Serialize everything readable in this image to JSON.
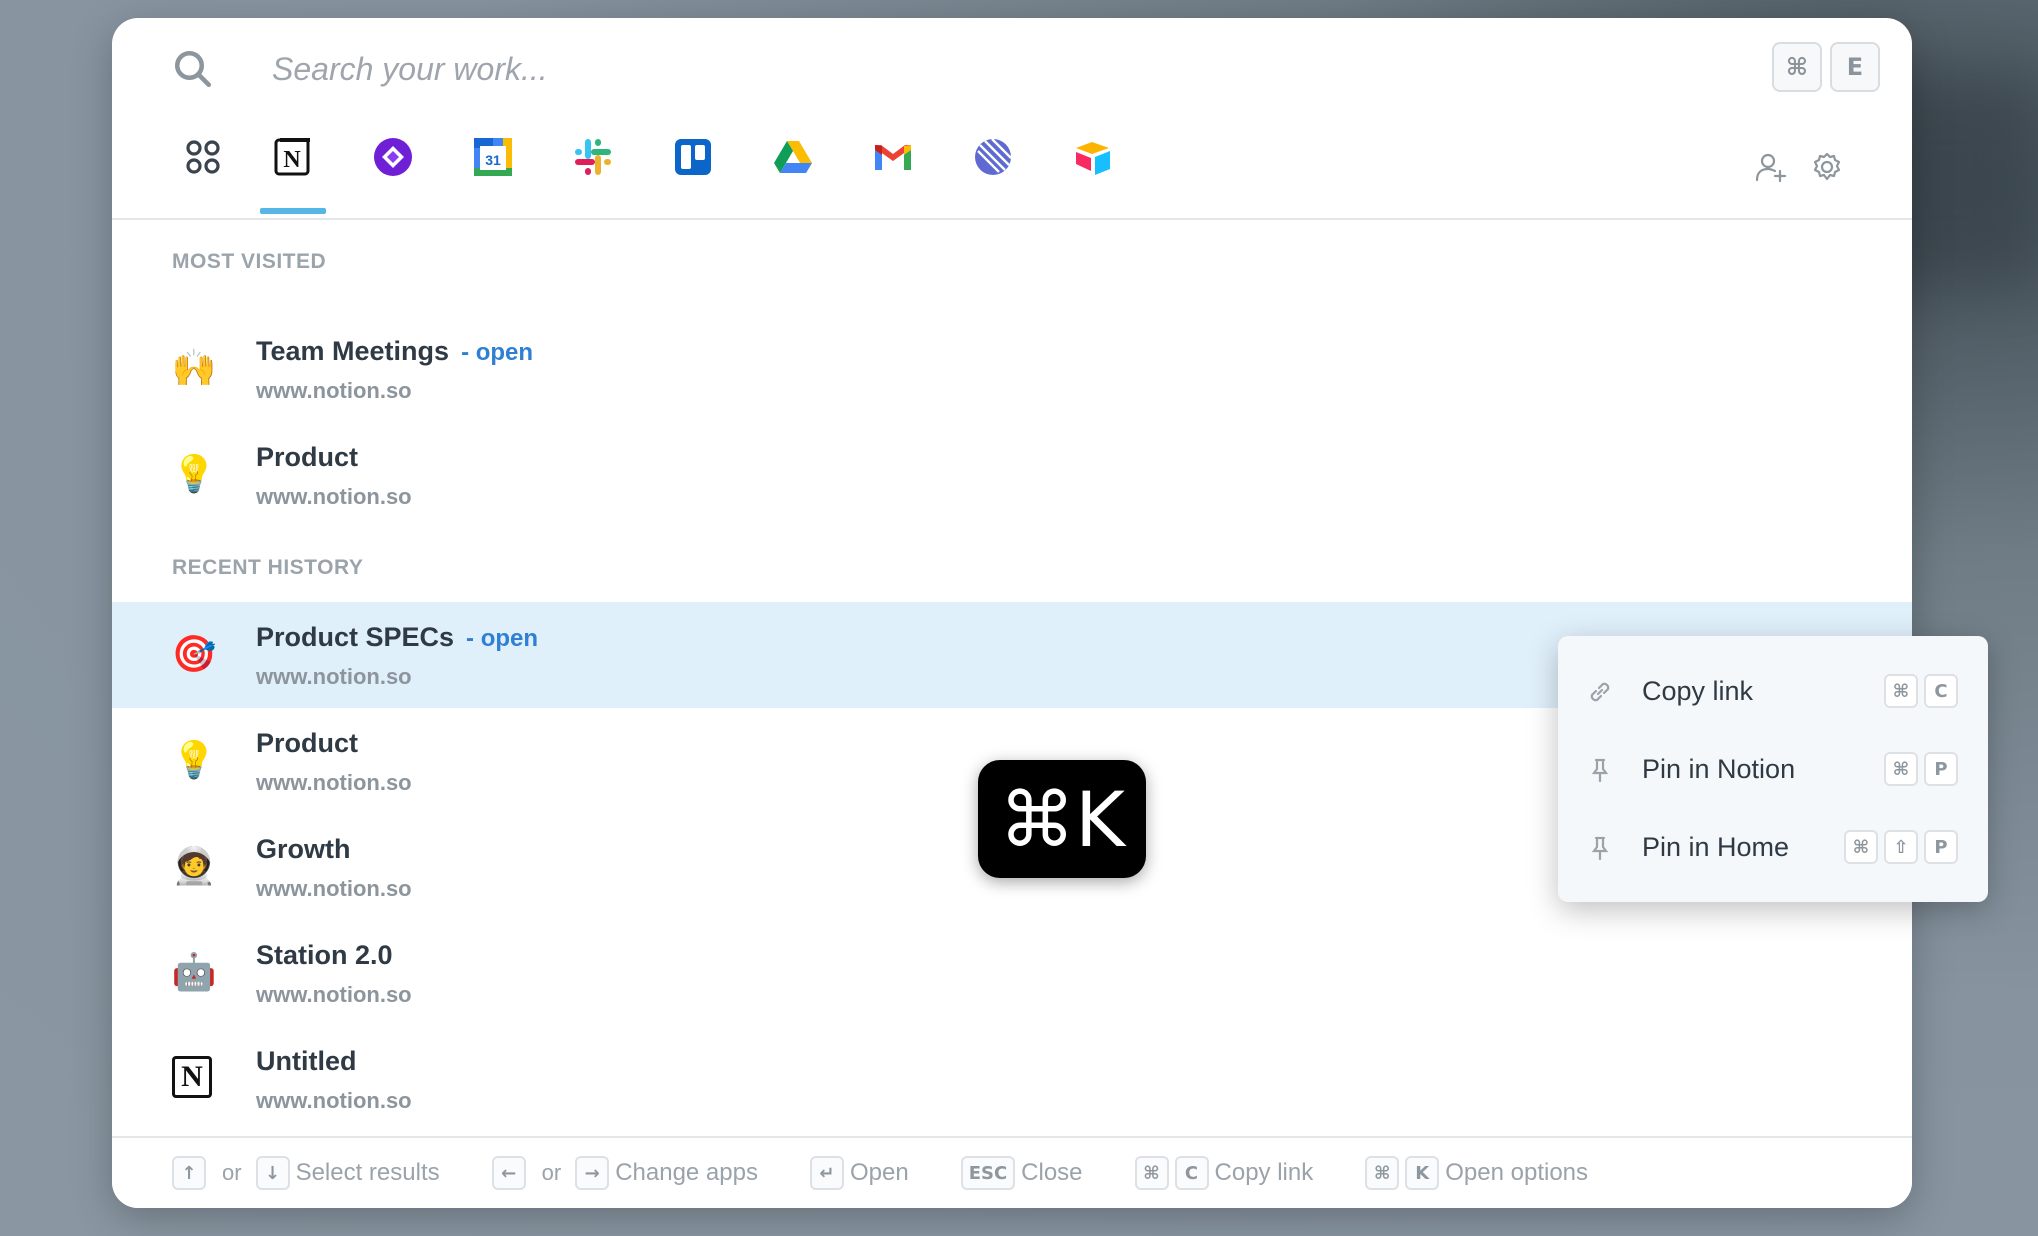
{
  "search": {
    "placeholder": "Search your work...",
    "shortcut": [
      "⌘",
      "E"
    ]
  },
  "apps": [
    {
      "name": "all-apps-icon"
    },
    {
      "name": "notion-icon"
    },
    {
      "name": "clickup-icon"
    },
    {
      "name": "google-calendar-icon",
      "label": "31"
    },
    {
      "name": "slack-icon"
    },
    {
      "name": "trello-icon"
    },
    {
      "name": "google-drive-icon"
    },
    {
      "name": "gmail-icon"
    },
    {
      "name": "linear-icon"
    },
    {
      "name": "airtable-icon"
    }
  ],
  "sections": {
    "most_visited": "MOST VISITED",
    "recent_history": "RECENT HISTORY"
  },
  "most_visited": [
    {
      "emoji": "🙌",
      "title": "Team Meetings",
      "open": "- open",
      "url": "www.notion.so"
    },
    {
      "emoji": "💡",
      "title": "Product",
      "url": "www.notion.so"
    }
  ],
  "recent_history": [
    {
      "emoji": "🎯",
      "title": "Product SPECs",
      "open": "- open",
      "url": "www.notion.so"
    },
    {
      "emoji": "💡",
      "title": "Product",
      "url": "www.notion.so"
    },
    {
      "emoji": "🧑‍🚀",
      "title": "Growth",
      "url": "www.notion.so"
    },
    {
      "emoji": "🤖",
      "title": "Station 2.0",
      "url": "www.notion.so"
    },
    {
      "emoji": "N",
      "title": "Untitled",
      "url": "www.notion.so"
    }
  ],
  "footer": {
    "up": "↑",
    "down": "↓",
    "or": "or",
    "select": "Select results",
    "left": "←",
    "right": "→",
    "change": "Change apps",
    "enter": "↵",
    "open": "Open",
    "esc": "ESC",
    "close": "Close",
    "cmd": "⌘",
    "c": "C",
    "copy": "Copy link",
    "k": "K",
    "options": "Open options"
  },
  "cmdk_badge": "⌘K",
  "context_menu": [
    {
      "label": "Copy link",
      "keys": [
        "⌘",
        "C"
      ]
    },
    {
      "label": "Pin in Notion",
      "keys": [
        "⌘",
        "P"
      ]
    },
    {
      "label": "Pin in Home",
      "keys": [
        "⌘",
        "⇧",
        "P"
      ]
    }
  ]
}
